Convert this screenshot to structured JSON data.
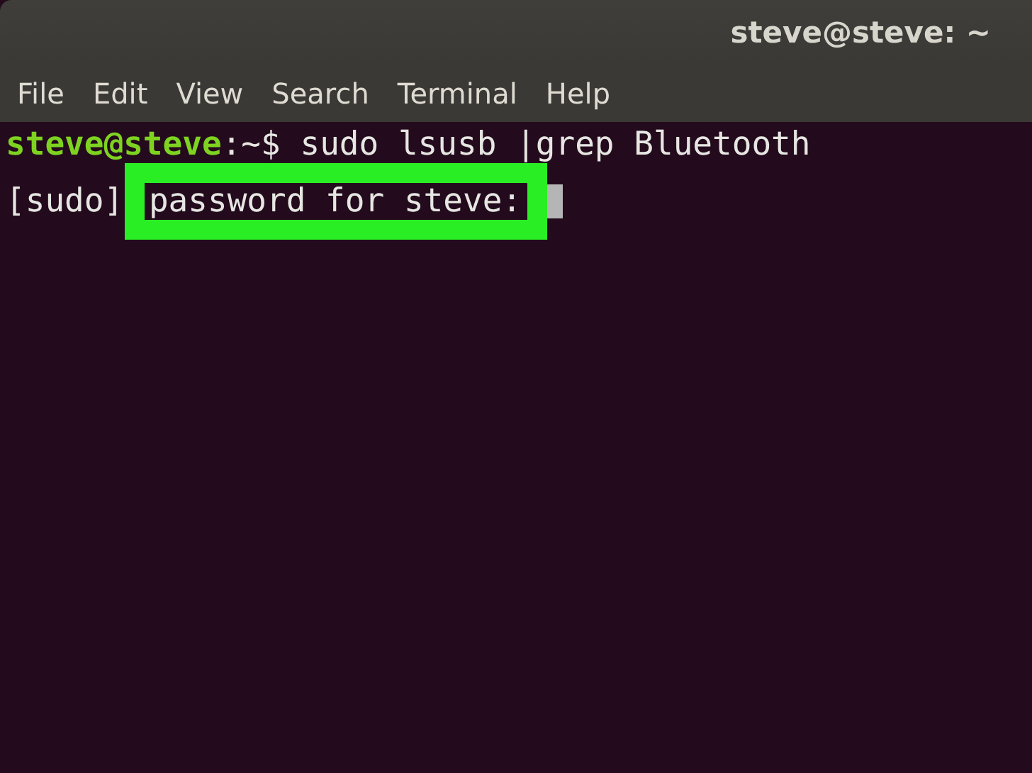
{
  "window": {
    "title": "steve@steve: ~"
  },
  "menu": [
    {
      "label": "File"
    },
    {
      "label": "Edit"
    },
    {
      "label": "View"
    },
    {
      "label": "Search"
    },
    {
      "label": "Terminal"
    },
    {
      "label": "Help"
    }
  ],
  "terminal": {
    "lines": [
      {
        "kind": "prompt",
        "prompt": "steve@steve",
        "text": ":~$ sudo lsusb |grep Bluetooth"
      },
      {
        "kind": "sudo",
        "prefix": "[sudo] ",
        "text": "password for steve:",
        "cursor": true
      }
    ]
  }
}
